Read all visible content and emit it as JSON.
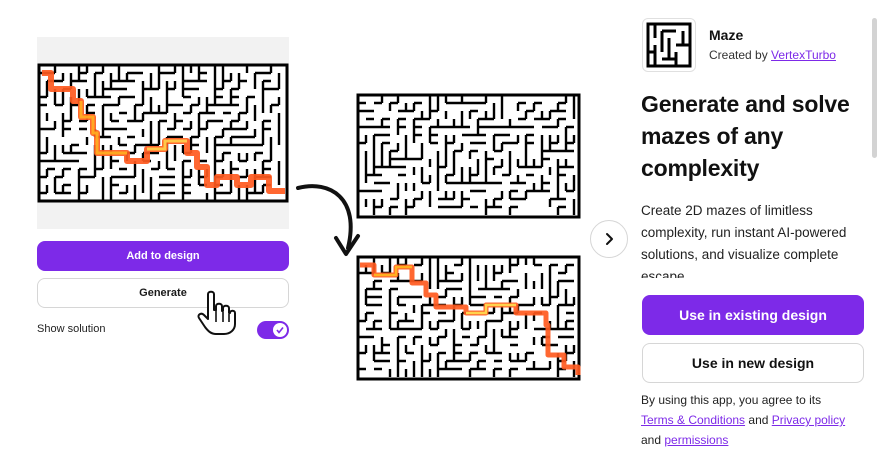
{
  "left_panel": {
    "add_button_label": "Add to design",
    "generate_button_label": "Generate",
    "show_solution_label": "Show solution",
    "show_solution_enabled": true
  },
  "app": {
    "name": "Maze",
    "created_by_prefix": "Created by",
    "author": "VertexTurbo",
    "headline": "Generate and solve mazes of any complexity",
    "description": "Create 2D mazes of limitless complexity, run instant AI-powered solutions, and visualize complete escape",
    "primary_button_label": "Use in existing design",
    "secondary_button_label": "Use in new design",
    "legal": {
      "prefix": "By using this app, you agree to its",
      "terms_link": "Terms & Conditions",
      "and1": "and",
      "privacy_link": "Privacy policy",
      "and2": "and",
      "permissions_link": "permissions"
    }
  },
  "colors": {
    "accent": "#7d2ae8",
    "solution_hot": "#ff5a1f",
    "solution_warm": "#ffb020"
  },
  "icons": {
    "next": "chevron-right-icon",
    "cursor": "hand-pointer-icon",
    "arrow": "curved-arrow-icon",
    "check": "check-icon"
  }
}
